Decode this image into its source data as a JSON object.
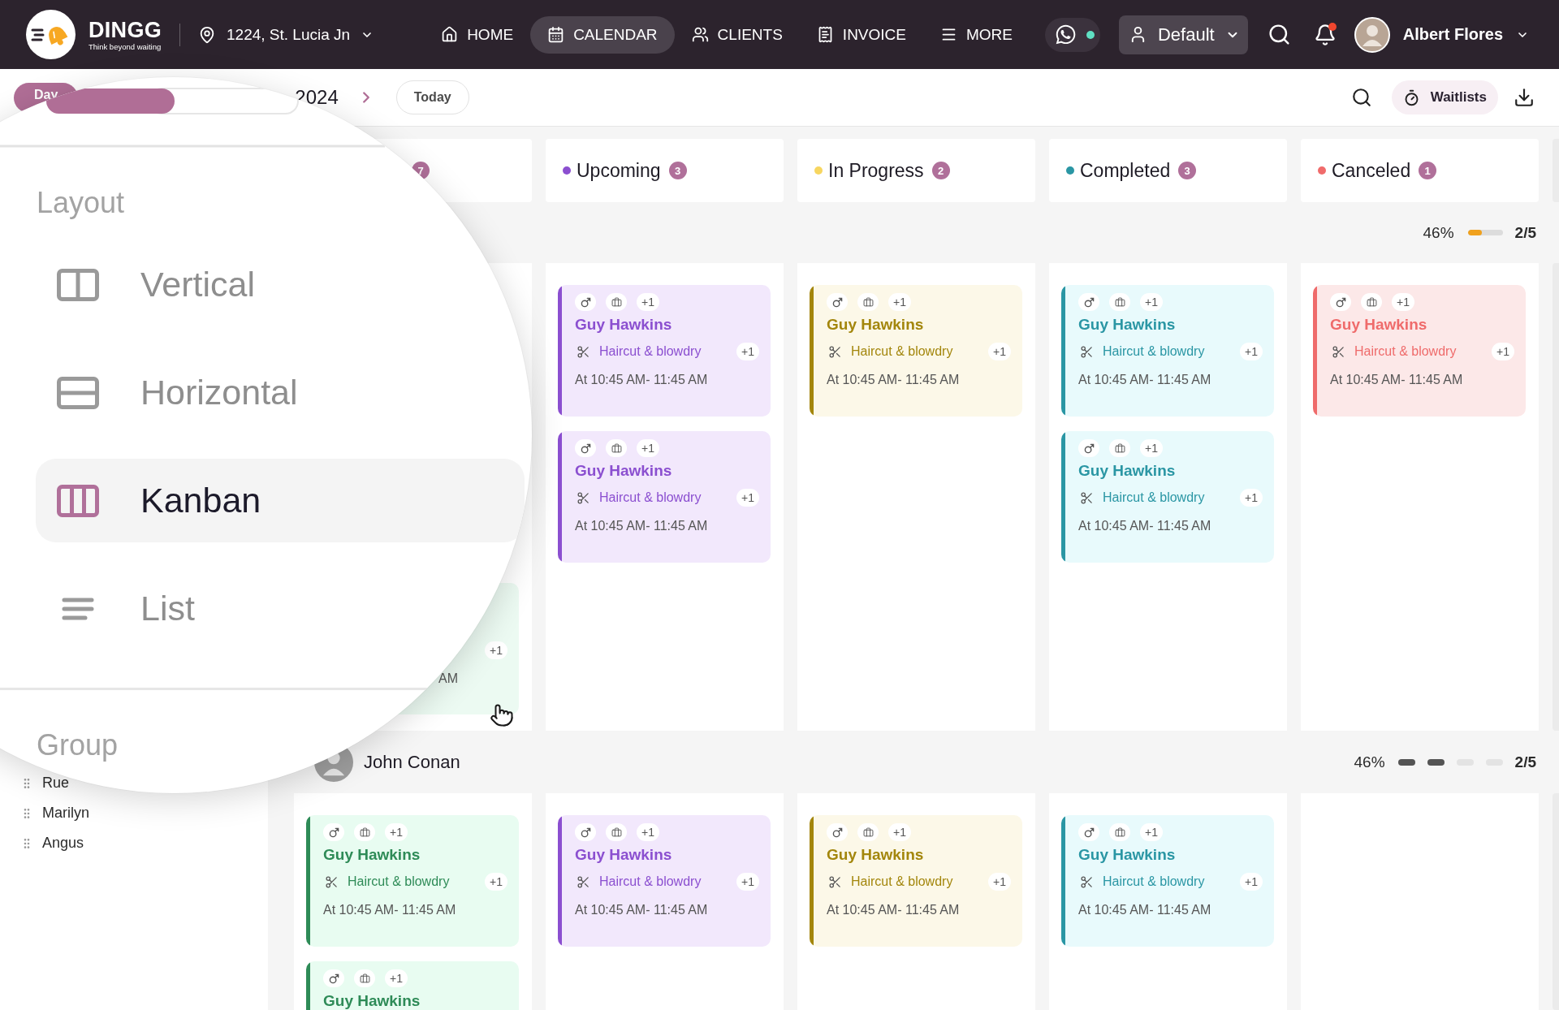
{
  "nav": {
    "brand": {
      "name": "DINGG",
      "tagline": "Think beyond waiting"
    },
    "location": "1224, St. Lucia Jn",
    "items": [
      {
        "label": "HOME",
        "selected": false
      },
      {
        "label": "CALENDAR",
        "selected": true
      },
      {
        "label": "CLIENTS",
        "selected": false
      },
      {
        "label": "INVOICE",
        "selected": false
      },
      {
        "label": "MORE",
        "selected": false
      }
    ],
    "whatsapp": {
      "online": true
    },
    "profile": "Default",
    "notifications": {
      "unread": true
    },
    "user": {
      "name": "Albert Flores"
    }
  },
  "toolbar": {
    "view_tabs": [
      {
        "label": "Day",
        "selected": true
      }
    ],
    "date": "2024",
    "today": "Today",
    "waitlists": "Waitlists"
  },
  "layout_menu": {
    "title": "Layout",
    "options": [
      {
        "label": "Vertical",
        "kind": "vertical",
        "selected": false
      },
      {
        "label": "Horizontal",
        "kind": "horizontal",
        "selected": false
      },
      {
        "label": "Kanban",
        "kind": "kanban",
        "selected": true
      },
      {
        "label": "List",
        "kind": "list",
        "selected": false
      }
    ],
    "group_title": "Group"
  },
  "sidebar": {
    "groups": [
      {
        "label": "Rue"
      },
      {
        "label": "Marilyn"
      },
      {
        "label": "Angus"
      }
    ]
  },
  "board": {
    "columns": [
      {
        "count": "7"
      },
      {
        "label": "Upcoming",
        "count": "3",
        "color": "#8b4fd0"
      },
      {
        "label": "In Progress",
        "count": "2",
        "color": "#f7d660"
      },
      {
        "label": "Completed",
        "count": "3",
        "color": "#2a96a4"
      },
      {
        "label": "Canceled",
        "count": "1",
        "color": "#f06b6b"
      }
    ],
    "rows": [
      {
        "progress": {
          "kind": "bar",
          "reading": "46%",
          "level": 0.4,
          "count": "2/5"
        },
        "cells": [
          {
            "cards": [
              {
                "kind": "covered",
                "color": "#ecfaf2",
                "service_count": "+1",
                "time": "AM"
              }
            ]
          },
          {
            "cards": [
              {
                "kind": "full",
                "color": "#8b4fd0",
                "tag_count": "+1",
                "name": "Guy Hawkins",
                "service": "Haircut & blowdry",
                "service_count": "+1",
                "time": "At 10:45 AM- 11:45 AM"
              },
              {
                "kind": "full",
                "color": "#8b4fd0",
                "tag_count": "+1",
                "name": "Guy Hawkins",
                "service": "Haircut & blowdry",
                "service_count": "+1",
                "time": "At 10:45 AM- 11:45 AM"
              }
            ]
          },
          {
            "cards": [
              {
                "kind": "full",
                "color": "#a3860c",
                "tag_count": "+1",
                "name": "Guy Hawkins",
                "service": "Haircut & blowdry",
                "service_count": "+1",
                "time": "At 10:45 AM- 11:45 AM"
              }
            ]
          },
          {
            "cards": [
              {
                "kind": "full",
                "color": "#2a96a4",
                "tag_count": "+1",
                "name": "Guy Hawkins",
                "service": "Haircut & blowdry",
                "service_count": "+1",
                "time": "At 10:45 AM- 11:45 AM"
              },
              {
                "kind": "full",
                "color": "#2a96a4",
                "tag_count": "+1",
                "name": "Guy Hawkins",
                "service": "Haircut & blowdry",
                "service_count": "+1",
                "time": "At 10:45 AM- 11:45 AM"
              }
            ]
          },
          {
            "cards": [
              {
                "kind": "full",
                "color": "#ef6b6b",
                "tag_count": "+1",
                "name": "Guy Hawkins",
                "service": "Haircut & blowdry",
                "service_count": "+1",
                "time": "At 10:45 AM- 11:45 AM"
              }
            ]
          }
        ]
      },
      {
        "person": {
          "name": "John Conan"
        },
        "progress": {
          "kind": "steps",
          "reading": "46%",
          "steps": [
            {
              "done": true
            },
            {
              "done": true
            },
            {
              "done": false
            },
            {
              "done": false
            }
          ],
          "count": "2/5"
        },
        "cells": [
          {
            "cards": [
              {
                "kind": "full",
                "color": "#2e8b57",
                "tag_count": "+1",
                "name": "Guy Hawkins",
                "service": "Haircut & blowdry",
                "service_count": "+1",
                "time": "At 10:45 AM- 11:45 AM"
              },
              {
                "kind": "cut",
                "color": "#2e8b57",
                "tag_count": "+1",
                "name": "Guy Hawkins"
              }
            ]
          },
          {
            "cards": [
              {
                "kind": "full",
                "color": "#8b4fd0",
                "tag_count": "+1",
                "name": "Guy Hawkins",
                "service": "Haircut & blowdry",
                "service_count": "+1",
                "time": "At 10:45 AM- 11:45 AM"
              }
            ]
          },
          {
            "cards": [
              {
                "kind": "full",
                "color": "#a3860c",
                "tag_count": "+1",
                "name": "Guy Hawkins",
                "service": "Haircut & blowdry",
                "service_count": "+1",
                "time": "At 10:45 AM- 11:45 AM"
              }
            ]
          },
          {
            "cards": [
              {
                "kind": "full",
                "color": "#2a96a4",
                "tag_count": "+1",
                "name": "Guy Hawkins",
                "service": "Haircut & blowdry",
                "service_count": "+1",
                "time": "At 10:45 AM- 11:45 AM"
              }
            ]
          }
        ]
      }
    ]
  }
}
